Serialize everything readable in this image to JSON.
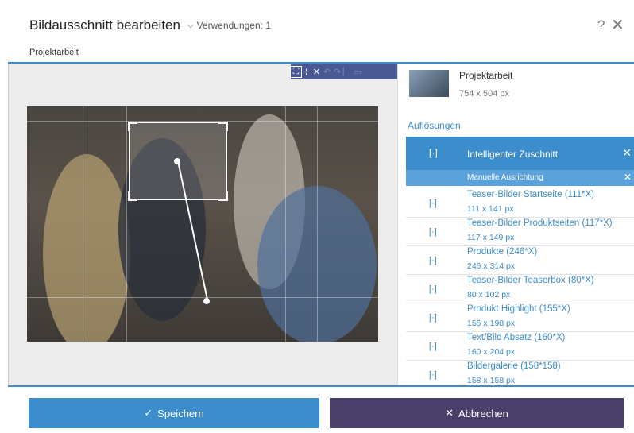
{
  "header": {
    "title": "Bildausschnitt bearbeiten",
    "usages": "Verwendungen: 1",
    "help": "?",
    "close": "✕"
  },
  "tab": {
    "label": "Projektarbeit"
  },
  "toolbar": [
    "⛶",
    "⊹",
    "✕",
    "↶",
    "↷",
    "⎸",
    "▭"
  ],
  "image": {
    "name": "Projektarbeit",
    "size": "754 x 504 px"
  },
  "resolutions_label": "Auflösungen",
  "smart_crop": {
    "label": "Intelligenter Zuschnitt",
    "close": "✕"
  },
  "manual": {
    "label": "Manuelle Ausrichtung",
    "close": "✕"
  },
  "resolutions": [
    {
      "name": "Teaser-Bilder Startseite (111*X)",
      "dims": "111 x 141 px"
    },
    {
      "name": "Teaser-Bilder Produktseiten (117*X)",
      "dims": "117 x 149 px"
    },
    {
      "name": "Produkte (246*X)",
      "dims": "246 x 314 px"
    },
    {
      "name": "Teaser-Bilder Teaserbox (80*X)",
      "dims": "80 x 102 px"
    },
    {
      "name": "Produkt Highlight (155*X)",
      "dims": "155 x 198 px"
    },
    {
      "name": "Text/Bild Absatz (160*X)",
      "dims": "160 x 204 px"
    },
    {
      "name": "Bildergalerie (158*158)",
      "dims": "158 x 158 px"
    }
  ],
  "footer": {
    "save": "Speichern",
    "cancel": "Abbrechen"
  },
  "colors": {
    "accent": "#3c8dcc",
    "cancel": "#4a3f6b",
    "toolbar": "#4a5894"
  }
}
